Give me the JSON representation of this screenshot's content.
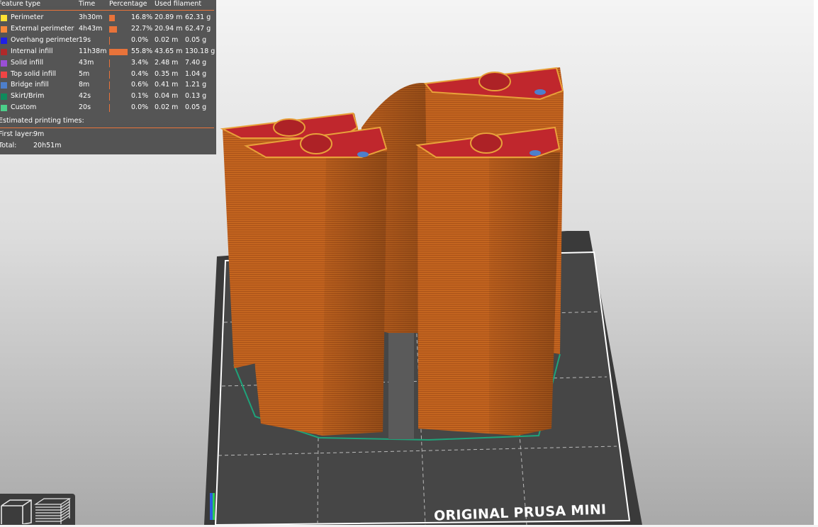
{
  "legend": {
    "headers": {
      "feature_type": "Feature type",
      "time": "Time",
      "percentage": "Percentage",
      "used_filament": "Used filament"
    },
    "rows": [
      {
        "name": "Perimeter",
        "time": "3h30m",
        "pct": "16.8%",
        "pct_value": 16.8,
        "len": "20.89 m",
        "weight": "62.31 g",
        "color": "#ffe133"
      },
      {
        "name": "External perimeter",
        "time": "4h43m",
        "pct": "22.7%",
        "pct_value": 22.7,
        "len": "20.94 m",
        "weight": "62.47 g",
        "color": "#f7883a"
      },
      {
        "name": "Overhang perimeter",
        "time": "19s",
        "pct": "0.0%",
        "pct_value": 0.0,
        "len": "0.02 m",
        "weight": "0.05 g",
        "color": "#1f1fe6"
      },
      {
        "name": "Internal infill",
        "time": "11h38m",
        "pct": "55.8%",
        "pct_value": 55.8,
        "len": "43.65 m",
        "weight": "130.18 g",
        "color": "#b02a2a"
      },
      {
        "name": "Solid infill",
        "time": "43m",
        "pct": "3.4%",
        "pct_value": 3.4,
        "len": "2.48 m",
        "weight": "7.40 g",
        "color": "#9a4fd6"
      },
      {
        "name": "Top solid infill",
        "time": "5m",
        "pct": "0.4%",
        "pct_value": 0.4,
        "len": "0.35 m",
        "weight": "1.04 g",
        "color": "#f04444"
      },
      {
        "name": "Bridge infill",
        "time": "8m",
        "pct": "0.6%",
        "pct_value": 0.6,
        "len": "0.41 m",
        "weight": "1.21 g",
        "color": "#4d7fcc"
      },
      {
        "name": "Skirt/Brim",
        "time": "42s",
        "pct": "0.1%",
        "pct_value": 0.1,
        "len": "0.04 m",
        "weight": "0.13 g",
        "color": "#0f8a5c"
      },
      {
        "name": "Custom",
        "time": "20s",
        "pct": "0.0%",
        "pct_value": 0.0,
        "len": "0.02 m",
        "weight": "0.05 g",
        "color": "#4ccf8a"
      }
    ],
    "estimated_title": "Estimated printing times:",
    "first_layer_label": "First layer:",
    "first_layer_value": "9m",
    "total_label": "Total:",
    "total_value": "20h51m"
  },
  "bed": {
    "label": "ORIGINAL PRUSA MINI"
  },
  "view_buttons": [
    {
      "icon": "cube-view-icon"
    },
    {
      "icon": "layers-view-icon"
    }
  ],
  "colors": {
    "accent": "#e8733a",
    "panel": "#484848",
    "model": "#c86a22",
    "top": "#c0272d",
    "bed": "#3a3a3a"
  }
}
